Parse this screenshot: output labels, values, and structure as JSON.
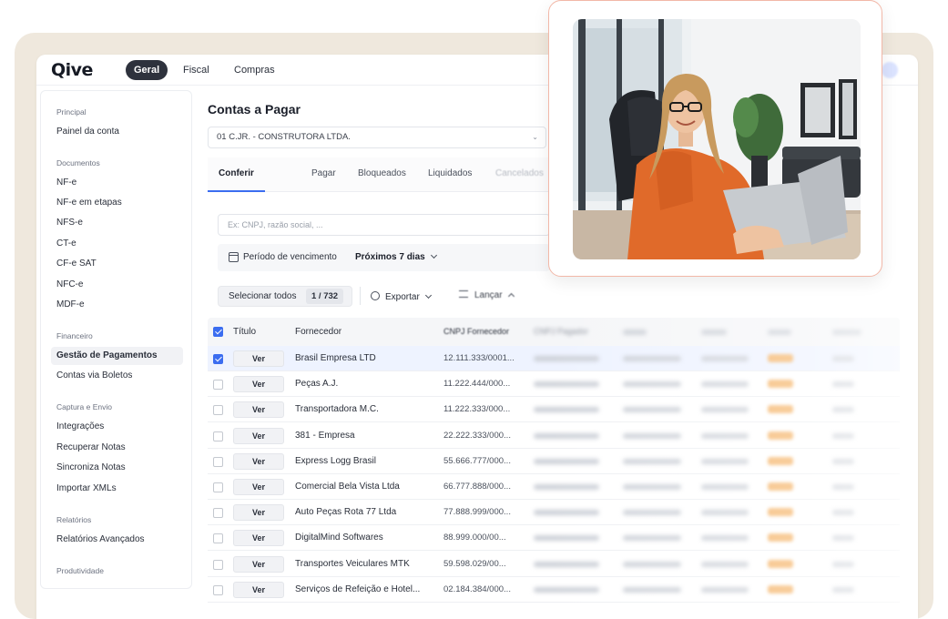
{
  "brand": {
    "logo": "Qive",
    "accent": "#3b6df0",
    "card_border": "#f2b8a8"
  },
  "topnav": {
    "tabs": [
      {
        "label": "Geral",
        "active": true
      },
      {
        "label": "Fiscal"
      },
      {
        "label": "Compras"
      }
    ]
  },
  "sidebar": {
    "groups": [
      {
        "title": "Principal",
        "items": [
          "Painel da conta"
        ]
      },
      {
        "title": "Documentos",
        "items": [
          "NF-e",
          "NF-e em etapas",
          "NFS-e",
          "CT-e",
          "CF-e SAT",
          "NFC-e",
          "MDF-e"
        ]
      },
      {
        "title": "Financeiro",
        "items": [
          "Gestão de Pagamentos",
          "Contas via Boletos"
        ],
        "active": "Gestão de Pagamentos"
      },
      {
        "title": "Captura e Envio",
        "items": [
          "Integrações",
          "Recuperar Notas",
          "Sincroniza Notas",
          "Importar XMLs"
        ]
      },
      {
        "title": "Relatórios",
        "items": [
          "Relatórios Avançados"
        ]
      },
      {
        "title": "Produtividade",
        "items": []
      }
    ]
  },
  "main": {
    "title": "Contas a Pagar",
    "company_select": "01 C.JR. - CONSTRUTORA LTDA.",
    "tabs": [
      "Conferir",
      "Pagar",
      "Bloqueados",
      "Liquidados",
      "Cancelados"
    ],
    "active_tab": "Conferir",
    "search_placeholder": "Ex: CNPJ, razão social, ...",
    "filter": {
      "label": "Período de vencimento",
      "value": "Próximos 7 dias"
    },
    "toolbar": {
      "select_all": "Selecionar todos",
      "count": "1 / 732",
      "export": "Exportar",
      "launch": "Lançar"
    }
  },
  "table": {
    "columns": [
      "Título",
      "Fornecedor",
      "CNPJ Fornecedor",
      "CNPJ Pagador"
    ],
    "button_label": "Ver",
    "rows": [
      {
        "fornecedor": "Brasil Empresa LTD",
        "cnpj": "12.111.333/0001...",
        "selected": true
      },
      {
        "fornecedor": "Peças A.J.",
        "cnpj": "11.222.444/000..."
      },
      {
        "fornecedor": "Transportadora M.C.",
        "cnpj": "11.222.333/000..."
      },
      {
        "fornecedor": "381 - Empresa",
        "cnpj": "22.222.333/000..."
      },
      {
        "fornecedor": "Express Logg Brasil",
        "cnpj": "55.666.777/000..."
      },
      {
        "fornecedor": "Comercial Bela Vista Ltda",
        "cnpj": "66.777.888/000..."
      },
      {
        "fornecedor": "Auto Peças Rota 77 Ltda",
        "cnpj": "77.888.999/000..."
      },
      {
        "fornecedor": "DigitalMind Softwares",
        "cnpj": "88.999.000/00..."
      },
      {
        "fornecedor": "Transportes Veiculares MTK",
        "cnpj": "59.598.029/00..."
      },
      {
        "fornecedor": "Serviços de Refeição e Hotel...",
        "cnpj": "02.184.384/000..."
      }
    ]
  }
}
